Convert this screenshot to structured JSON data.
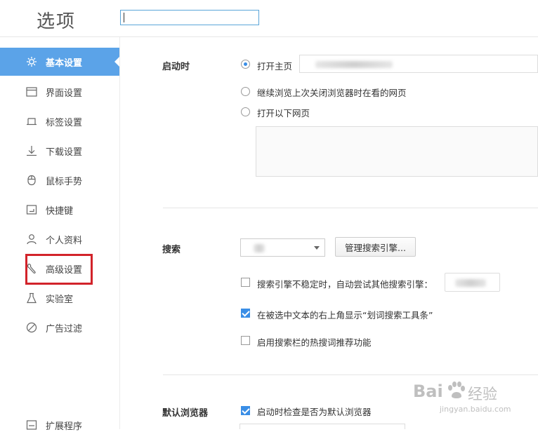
{
  "header": {
    "title": "选项",
    "search_value": ""
  },
  "sidebar": {
    "items": [
      {
        "label": "基本设置",
        "icon": "gear-icon",
        "active": true
      },
      {
        "label": "界面设置",
        "icon": "window-icon"
      },
      {
        "label": "标签设置",
        "icon": "tab-icon"
      },
      {
        "label": "下载设置",
        "icon": "download-icon"
      },
      {
        "label": "鼠标手势",
        "icon": "mouse-icon"
      },
      {
        "label": "快捷键",
        "icon": "keyboard-icon"
      },
      {
        "label": "个人资料",
        "icon": "person-icon"
      },
      {
        "label": "高级设置",
        "icon": "wrench-icon"
      },
      {
        "label": "实验室",
        "icon": "flask-icon"
      },
      {
        "label": "广告过滤",
        "icon": "block-icon"
      },
      {
        "label": "扩展程序",
        "icon": "extension-icon"
      }
    ]
  },
  "startup": {
    "label": "启动时",
    "options": [
      {
        "label": "打开主页",
        "checked": true
      },
      {
        "label": "继续浏览上次关闭浏览器时在看的网页",
        "checked": false
      },
      {
        "label": "打开以下网页",
        "checked": false
      }
    ]
  },
  "search": {
    "label": "搜索",
    "manage_button": "管理搜索引擎...",
    "options": [
      {
        "label": "搜索引擎不稳定时，自动尝试其他搜索引擎：",
        "checked": false
      },
      {
        "label": "在被选中文本的右上角显示“划词搜索工具条”",
        "checked": true
      },
      {
        "label": "启用搜索栏的热搜词推荐功能",
        "checked": false
      }
    ]
  },
  "default_browser": {
    "label": "默认浏览器",
    "options": [
      {
        "label": "启动时检查是否为默认浏览器",
        "checked": true
      }
    ]
  },
  "watermark": {
    "brand": "Bai",
    "brand_suffix": "经验",
    "url": "jingyan.baidu.com"
  },
  "colors": {
    "accent": "#5ba3e8",
    "highlight_box": "#d2232a",
    "checkbox": "#3a8ee6"
  }
}
